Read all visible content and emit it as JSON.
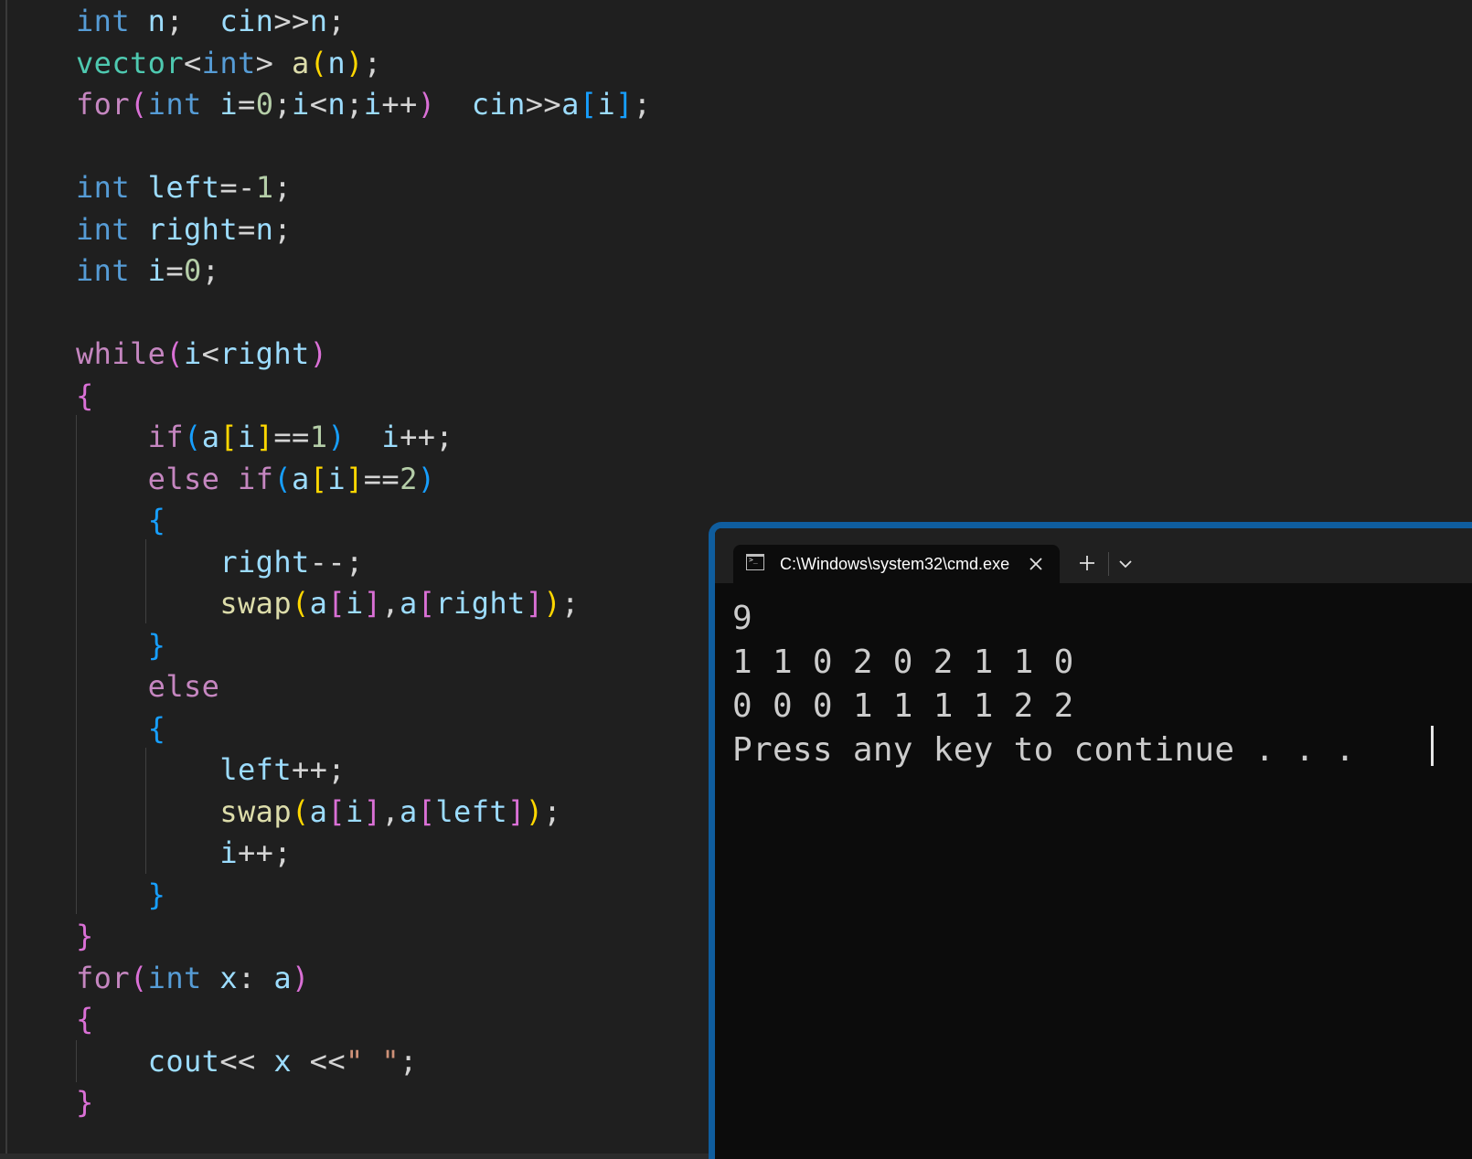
{
  "editor": {
    "lines": [
      [
        [
          "kw",
          "int"
        ],
        [
          "op",
          " "
        ],
        [
          "var",
          "n"
        ],
        [
          "op",
          ";  "
        ],
        [
          "var",
          "cin"
        ],
        [
          "op",
          ">>"
        ],
        [
          "var",
          "n"
        ],
        [
          "op",
          ";"
        ]
      ],
      [
        [
          "type",
          "vector"
        ],
        [
          "op",
          "<"
        ],
        [
          "kw",
          "int"
        ],
        [
          "op",
          "> "
        ],
        [
          "fn",
          "a"
        ],
        [
          "b1",
          "("
        ],
        [
          "var",
          "n"
        ],
        [
          "b1",
          ")"
        ],
        [
          "op",
          ";"
        ]
      ],
      [
        [
          "ctl",
          "for"
        ],
        [
          "b2",
          "("
        ],
        [
          "kw",
          "int"
        ],
        [
          "op",
          " "
        ],
        [
          "var",
          "i"
        ],
        [
          "op",
          "="
        ],
        [
          "num",
          "0"
        ],
        [
          "op",
          ";"
        ],
        [
          "var",
          "i"
        ],
        [
          "op",
          "<"
        ],
        [
          "var",
          "n"
        ],
        [
          "op",
          ";"
        ],
        [
          "var",
          "i"
        ],
        [
          "op",
          "++"
        ],
        [
          "b2",
          ")"
        ],
        [
          "op",
          "  "
        ],
        [
          "var",
          "cin"
        ],
        [
          "op",
          ">>"
        ],
        [
          "var",
          "a"
        ],
        [
          "b3",
          "["
        ],
        [
          "var",
          "i"
        ],
        [
          "b3",
          "]"
        ],
        [
          "op",
          ";"
        ]
      ],
      [],
      [
        [
          "kw",
          "int"
        ],
        [
          "op",
          " "
        ],
        [
          "var",
          "left"
        ],
        [
          "op",
          "=-"
        ],
        [
          "num",
          "1"
        ],
        [
          "op",
          ";"
        ]
      ],
      [
        [
          "kw",
          "int"
        ],
        [
          "op",
          " "
        ],
        [
          "var",
          "right"
        ],
        [
          "op",
          "="
        ],
        [
          "var",
          "n"
        ],
        [
          "op",
          ";"
        ]
      ],
      [
        [
          "kw",
          "int"
        ],
        [
          "op",
          " "
        ],
        [
          "var",
          "i"
        ],
        [
          "op",
          "="
        ],
        [
          "num",
          "0"
        ],
        [
          "op",
          ";"
        ]
      ],
      [],
      [
        [
          "ctl",
          "while"
        ],
        [
          "b2",
          "("
        ],
        [
          "var",
          "i"
        ],
        [
          "op",
          "<"
        ],
        [
          "var",
          "right"
        ],
        [
          "b2",
          ")"
        ]
      ],
      [
        [
          "b2",
          "{"
        ]
      ],
      [
        [
          "op",
          "    "
        ],
        [
          "ctl",
          "if"
        ],
        [
          "b3",
          "("
        ],
        [
          "var",
          "a"
        ],
        [
          "b1",
          "["
        ],
        [
          "var",
          "i"
        ],
        [
          "b1",
          "]"
        ],
        [
          "op",
          "=="
        ],
        [
          "num",
          "1"
        ],
        [
          "b3",
          ")"
        ],
        [
          "op",
          "  "
        ],
        [
          "var",
          "i"
        ],
        [
          "op",
          "++;"
        ]
      ],
      [
        [
          "op",
          "    "
        ],
        [
          "ctl",
          "else"
        ],
        [
          "op",
          " "
        ],
        [
          "ctl",
          "if"
        ],
        [
          "b3",
          "("
        ],
        [
          "var",
          "a"
        ],
        [
          "b1",
          "["
        ],
        [
          "var",
          "i"
        ],
        [
          "b1",
          "]"
        ],
        [
          "op",
          "=="
        ],
        [
          "num",
          "2"
        ],
        [
          "b3",
          ")"
        ]
      ],
      [
        [
          "op",
          "    "
        ],
        [
          "b3",
          "{"
        ]
      ],
      [
        [
          "op",
          "        "
        ],
        [
          "var",
          "right"
        ],
        [
          "op",
          "--;"
        ]
      ],
      [
        [
          "op",
          "        "
        ],
        [
          "fn",
          "swap"
        ],
        [
          "b1",
          "("
        ],
        [
          "var",
          "a"
        ],
        [
          "b2",
          "["
        ],
        [
          "var",
          "i"
        ],
        [
          "b2",
          "]"
        ],
        [
          "op",
          ","
        ],
        [
          "var",
          "a"
        ],
        [
          "b2",
          "["
        ],
        [
          "var",
          "right"
        ],
        [
          "b2",
          "]"
        ],
        [
          "b1",
          ")"
        ],
        [
          "op",
          ";"
        ]
      ],
      [
        [
          "op",
          "    "
        ],
        [
          "b3",
          "}"
        ]
      ],
      [
        [
          "op",
          "    "
        ],
        [
          "ctl",
          "else"
        ]
      ],
      [
        [
          "op",
          "    "
        ],
        [
          "b3",
          "{"
        ]
      ],
      [
        [
          "op",
          "        "
        ],
        [
          "var",
          "left"
        ],
        [
          "op",
          "++;"
        ]
      ],
      [
        [
          "op",
          "        "
        ],
        [
          "fn",
          "swap"
        ],
        [
          "b1",
          "("
        ],
        [
          "var",
          "a"
        ],
        [
          "b2",
          "["
        ],
        [
          "var",
          "i"
        ],
        [
          "b2",
          "]"
        ],
        [
          "op",
          ","
        ],
        [
          "var",
          "a"
        ],
        [
          "b2",
          "["
        ],
        [
          "var",
          "left"
        ],
        [
          "b2",
          "]"
        ],
        [
          "b1",
          ")"
        ],
        [
          "op",
          ";"
        ]
      ],
      [
        [
          "op",
          "        "
        ],
        [
          "var",
          "i"
        ],
        [
          "op",
          "++;"
        ]
      ],
      [
        [
          "op",
          "    "
        ],
        [
          "b3",
          "}"
        ]
      ],
      [
        [
          "b2",
          "}"
        ]
      ],
      [
        [
          "ctl",
          "for"
        ],
        [
          "b2",
          "("
        ],
        [
          "kw",
          "int"
        ],
        [
          "op",
          " "
        ],
        [
          "var",
          "x"
        ],
        [
          "op",
          ": "
        ],
        [
          "var",
          "a"
        ],
        [
          "b2",
          ")"
        ]
      ],
      [
        [
          "b2",
          "{"
        ]
      ],
      [
        [
          "op",
          "    "
        ],
        [
          "var",
          "cout"
        ],
        [
          "op",
          "<< "
        ],
        [
          "var",
          "x"
        ],
        [
          "op",
          " <<"
        ],
        [
          "str",
          "\" \""
        ],
        [
          "op",
          ";"
        ]
      ],
      [
        [
          "b2",
          "}"
        ]
      ]
    ]
  },
  "terminal": {
    "tab_title": "C:\\Windows\\system32\\cmd.exe",
    "tab_icon": "console-icon",
    "close_icon": "close-icon",
    "new_tab_icon": "plus-icon",
    "dropdown_icon": "chevron-down-icon",
    "output": [
      "9",
      "1 1 0 2 0 2 1 1 0",
      "0 0 0 1 1 1 1 2 2",
      "Press any key to continue . . ."
    ]
  },
  "colors": {
    "editor_background": "#1f1f1f",
    "terminal_background": "#0c0c0c",
    "terminal_border": "#0f5d9e",
    "keyword": "#569cd6",
    "control": "#c586c0",
    "type": "#4ec9b0",
    "variable": "#9cdcfe",
    "function": "#dcdcaa",
    "number": "#b5cea8",
    "string": "#ce9178"
  }
}
